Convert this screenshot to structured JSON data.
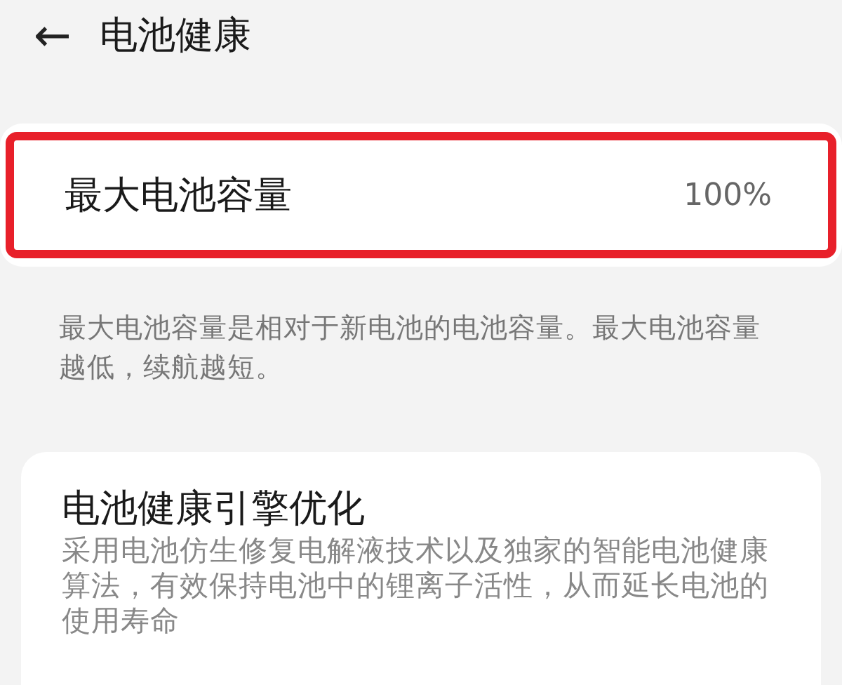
{
  "header": {
    "back": "←",
    "title": "电池健康"
  },
  "capacity": {
    "label": "最大电池容量",
    "value": "100%",
    "highlighted": true
  },
  "capacity_note": "最大电池容量是相对于新电池的电池容量。最大电池容量越低，续航越短。",
  "engine": {
    "title": "电池健康引擎优化",
    "description": "采用电池仿生修复电解液技术以及独家的智能电池健康算法，有效保持电池中的锂离子活性，从而延长电池的使用寿命"
  }
}
